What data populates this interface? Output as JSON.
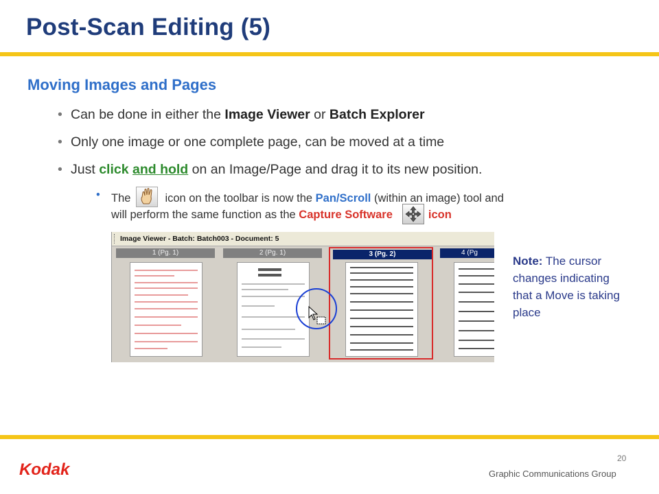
{
  "title": "Post-Scan Editing  (5)",
  "subtitle": "Moving Images and Pages",
  "bullets": {
    "b1": {
      "pre": "Can be done in either the ",
      "k1": "Image Viewer",
      "mid": " or ",
      "k2": "Batch Explorer"
    },
    "b2": {
      "text": "Only one image or one complete page, can be moved at a time"
    },
    "b3": {
      "pre": "Just ",
      "g1": "click",
      "sp": " ",
      "g2": "and hold",
      "post": " on an Image/Page and drag it to its new position."
    }
  },
  "sub_bullet": {
    "the": "The",
    "t1": "icon on the toolbar is now the ",
    "pan": "Pan/Scroll",
    "t2": " (within an image) tool and",
    "t3": "will perform the same function as the ",
    "capture": "Capture Software",
    "icon_word": "icon"
  },
  "viewer": {
    "title": "Image Viewer - Batch: Batch003 - Document: 5",
    "thumbnails": [
      "1 (Pg. 1)",
      "2 (Pg. 1)",
      "3 (Pg. 2)",
      "4 (Pg"
    ],
    "selected_index": 2
  },
  "note": {
    "label": "Note:",
    "text": " The cursor changes indicating that a Move is taking place"
  },
  "footer": {
    "page_number": "20",
    "group": "Graphic Communications Group",
    "logo_text": "Kodak"
  },
  "colors": {
    "title": "#1f3c7a",
    "accent_rule": "#f5c518",
    "subtitle": "#2f6fc9",
    "green": "#2e8b2e",
    "red": "#d8332a",
    "logo": "#e2231a"
  },
  "icons": [
    "hand-icon",
    "move-arrows-icon",
    "drag-cursor-icon"
  ]
}
